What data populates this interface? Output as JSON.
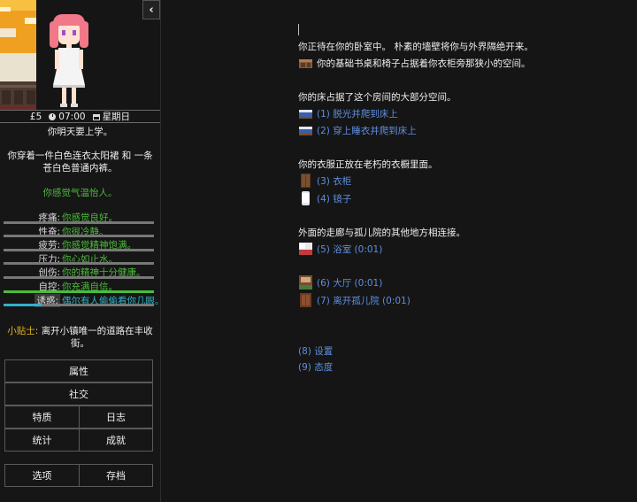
{
  "sidebar": {
    "collapse_icon": "chevron-left-icon",
    "status": {
      "money": "£5",
      "time": "07:00",
      "day": "星期日"
    },
    "school_note": "你明天要上学。",
    "outfit_line1": "你穿着一件白色连衣太阳裙 和 一条",
    "outfit_line2": "苍白色普通内裤。",
    "mood": "你感觉气温怡人。",
    "stats": [
      {
        "label": "疼痛:",
        "value": "你感觉良好。",
        "level": 0.0,
        "color": "#4cba3c"
      },
      {
        "label": "性奋:",
        "value": "你很冷静。",
        "level": 0.0,
        "color": "#4cba3c"
      },
      {
        "label": "疲劳:",
        "value": "你感觉精神饱满。",
        "level": 0.0,
        "color": "#4cba3c"
      },
      {
        "label": "压力:",
        "value": "你心如止水。",
        "level": 0.0,
        "color": "#4cba3c"
      },
      {
        "label": "创伤:",
        "value": "你的精神十分健康。",
        "level": 0.0,
        "color": "#4cba3c"
      },
      {
        "label": "自控:",
        "value": "你充满自信。",
        "level": 1.0,
        "color": "#4cba3c"
      },
      {
        "label": "诱惑:",
        "value": "偶尔有人偷偷看你几眼。",
        "level": 0.25,
        "color": "#2fb3c9"
      }
    ],
    "tip_label": "小贴士:",
    "tip_line1": "离开小镇唯一的道路在丰收",
    "tip_line2": "街。",
    "buttons": {
      "attributes": "属性",
      "social": "社交",
      "traits": "特质",
      "journal": "日志",
      "statistics": "统计",
      "achievements": "成就",
      "options": "选项",
      "saves": "存档"
    }
  },
  "main": {
    "intro_line1": "你正待在你的卧室中。 朴素的墙壁将你与外界隔绝开来。",
    "intro_line2": "你的基础书桌和椅子占据着你衣柜旁那狭小的空间。",
    "bed_text": "你的床占据了这个房间的大部分空间。",
    "bed_option1": "(1) 脱光并爬到床上",
    "bed_option2": "(2) 穿上睡衣并爬到床上",
    "wardrobe_text": "你的衣服正放在老朽的衣橱里面。",
    "wardrobe_option": "(3) 衣柜",
    "mirror_option": "(4) 镜子",
    "hall_text": "外面的走廊与孤儿院的其他地方相连接。",
    "bathroom_option": "(5) 浴室 (0:01)",
    "hall_option": "(6) 大厅 (0:01)",
    "leave_option": "(7) 离开孤儿院 (0:01)",
    "settings_option": "(8) 设置",
    "attitude_option": "(9) 态度"
  }
}
